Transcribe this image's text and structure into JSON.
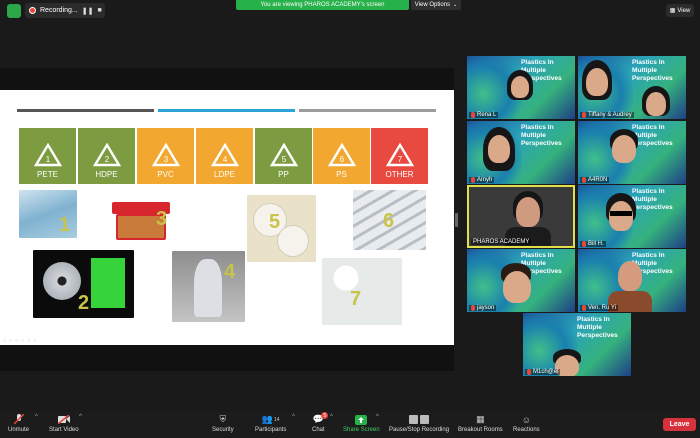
{
  "top": {
    "recording_label": "Recording...",
    "pause_glyph": "❚❚",
    "stop_glyph": "■",
    "banner_text": "You are viewing PHAROS ACADEMY's screen",
    "view_options_label": "View Options",
    "view_button_label": "View",
    "colors": {
      "banner": "#27b14a",
      "record": "#e8463c"
    }
  },
  "slide": {
    "recycle_codes": [
      {
        "number": "1",
        "label": "PETE",
        "color": "#7d9b41"
      },
      {
        "number": "2",
        "label": "HDPE",
        "color": "#7d9b41"
      },
      {
        "number": "3",
        "label": "PVC",
        "color": "#f1a730"
      },
      {
        "number": "4",
        "label": "LDPE",
        "color": "#f1a730"
      },
      {
        "number": "5",
        "label": "PP",
        "color": "#7d9b41"
      },
      {
        "number": "6",
        "label": "PS",
        "color": "#f1a730"
      },
      {
        "number": "7",
        "label": "OTHER",
        "color": "#e84a3f"
      }
    ],
    "photo_numbers": [
      "1",
      "2",
      "3",
      "4",
      "5",
      "6",
      "7"
    ],
    "line_colors": [
      "#555555",
      "#2aa5d8",
      "#9c9c9c"
    ]
  },
  "gallery": {
    "tile_title": "Plastics In Multiple Perspectives",
    "participants": [
      {
        "name": "Rena L"
      },
      {
        "name": "Tiffany & Audrey"
      },
      {
        "name": "Amyh"
      },
      {
        "name": "A4R0N"
      },
      {
        "name": "PHAROS ACADEMY"
      },
      {
        "name": "Bill H."
      },
      {
        "name": "jayson"
      },
      {
        "name": "Ven. Ru Yi"
      },
      {
        "name": "M1ch@el"
      }
    ]
  },
  "bottom": {
    "unmute": "Unmute",
    "start_video": "Start Video",
    "security": "Security",
    "participants": "Participants",
    "participants_count": "14",
    "chat": "Chat",
    "chat_badge": "5",
    "share_screen": "Share Screen",
    "pause_stop_recording": "Pause/Stop Recording",
    "breakout_rooms": "Breakout Rooms",
    "reactions": "Reactions",
    "leave": "Leave",
    "colors": {
      "share": "#27b14a",
      "leave": "#d6323c"
    }
  }
}
